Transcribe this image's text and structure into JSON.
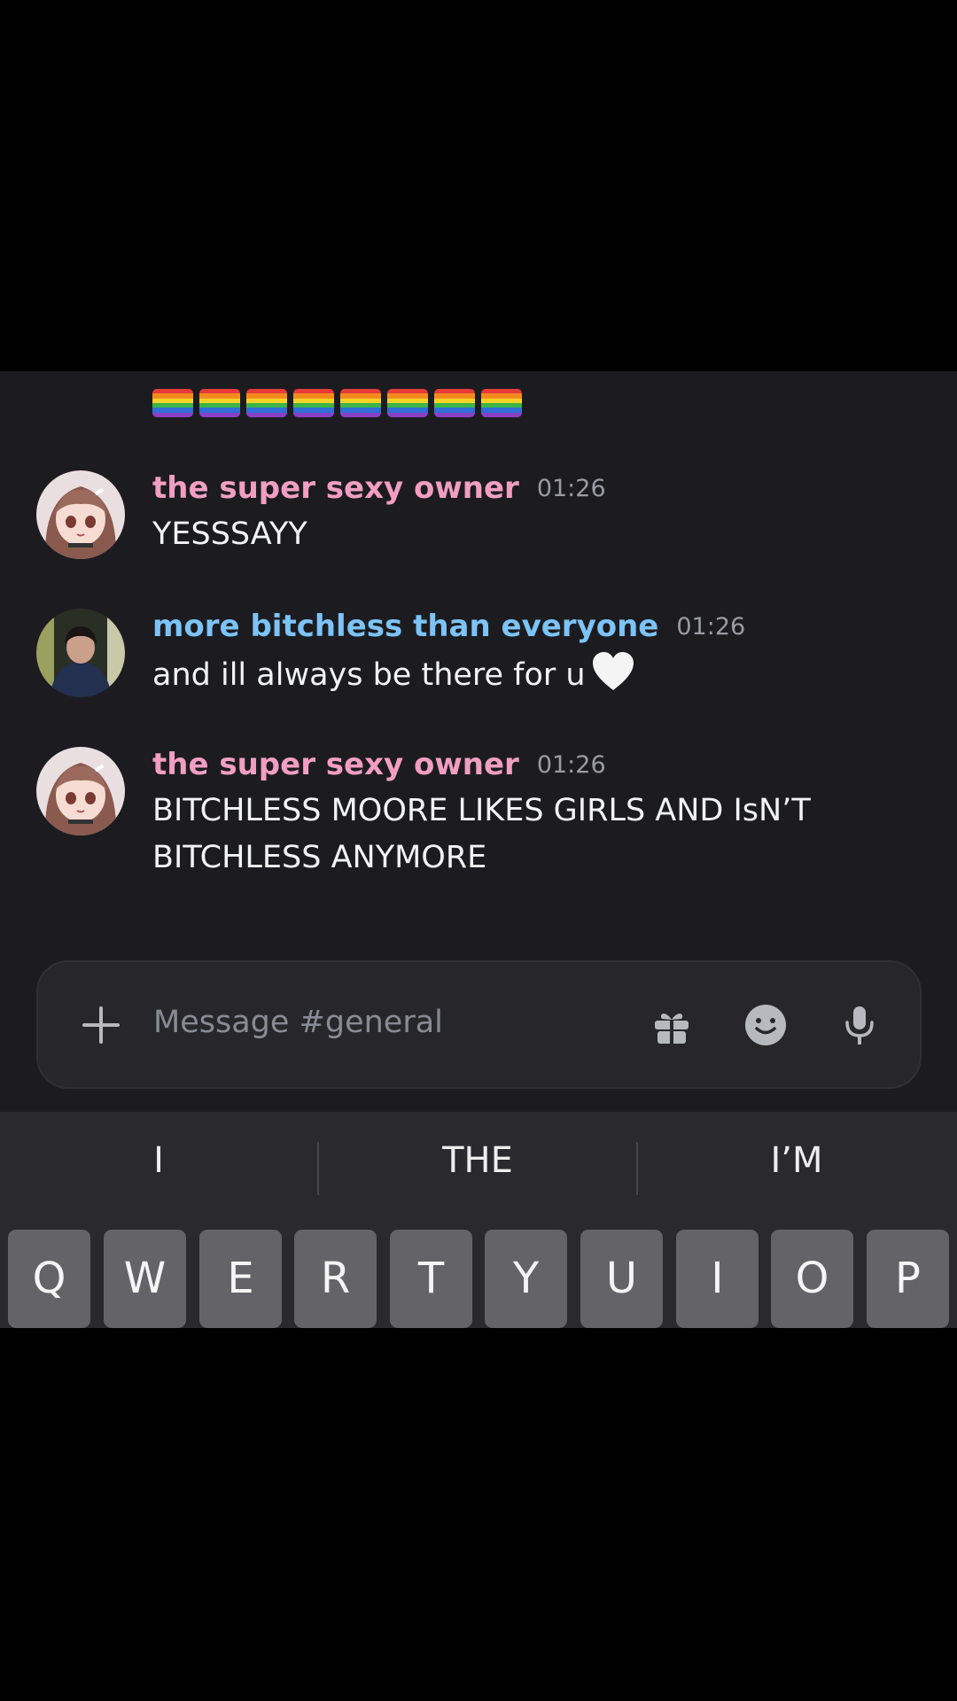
{
  "flags": {
    "count": 8,
    "emoji": "rainbow-flag"
  },
  "messages": [
    {
      "author": "the super sexy owner",
      "time": "01:26",
      "text": "YESSSAYY",
      "author_color": "#f19ec2"
    },
    {
      "author": "more bitchless than everyone",
      "time": "01:26",
      "text": "and ill always be there for u",
      "emoji": "white-heart",
      "author_color": "#7cc3f7"
    },
    {
      "author": "the super sexy owner",
      "time": "01:26",
      "text_line1": "BITCHLESS MOORE LIKES GIRLS AND IsN’T",
      "text_line2": "BITCHLESS ANYMORE",
      "author_color": "#f19ec2"
    }
  ],
  "composer": {
    "placeholder": "Message #general"
  },
  "keyboard": {
    "suggestions": [
      "I",
      "THE",
      "I’M"
    ],
    "row1": [
      "Q",
      "W",
      "E",
      "R",
      "T",
      "Y",
      "U",
      "I",
      "O",
      "P"
    ]
  },
  "colors": {
    "background": "#1c1c20",
    "input": "#27272b",
    "key": "#646468"
  }
}
